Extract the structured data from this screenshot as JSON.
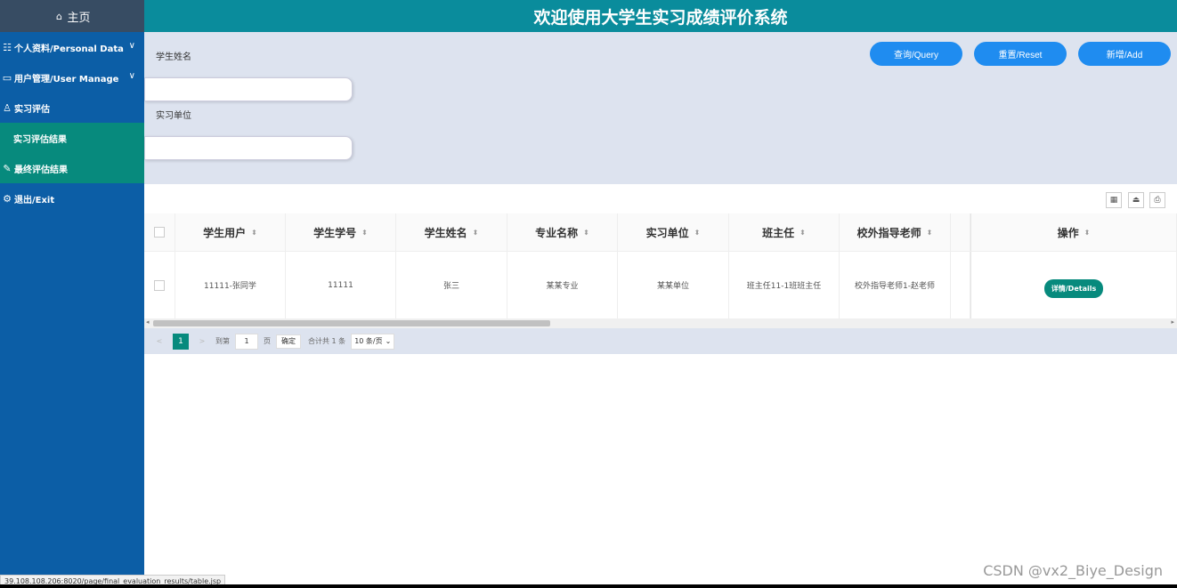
{
  "sidebar": {
    "home_label": "主页",
    "items": [
      {
        "label": "个人资料/Personal Data"
      },
      {
        "label": "用户管理/User Manage"
      },
      {
        "label": "实习评估"
      },
      {
        "label": "实习评估结果"
      },
      {
        "label": "最终评估结果"
      },
      {
        "label": "退出/Exit"
      }
    ]
  },
  "header": {
    "title": "欢迎使用大学生实习成绩评价系统"
  },
  "search": {
    "field1_label": "学生姓名",
    "field1_value": "",
    "field2_label": "实习单位",
    "field2_value": "",
    "query_label": "查询/Query",
    "reset_label": "重置/Reset",
    "add_label": "新增/Add"
  },
  "table": {
    "columns": [
      "学生用户",
      "学生学号",
      "学生姓名",
      "专业名称",
      "实习单位",
      "班主任",
      "校外指导老师",
      "操作"
    ],
    "rows": [
      {
        "user": "11111-张同学",
        "student_no": "11111",
        "name": "张三",
        "major": "某某专业",
        "unit": "某某单位",
        "teacher": "班主任11-1班班主任",
        "mentor": "校外指导老师1-赵老师",
        "action": "详情/Details"
      }
    ]
  },
  "pager": {
    "current_page": "1",
    "goto_label": "到第",
    "goto_value": "1",
    "page_unit": "页",
    "confirm_label": "确定",
    "total_label": "合计共 1 条",
    "page_size": "10 条/页"
  },
  "statusbar": {
    "url": "39.108.108.206:8020/page/final_evaluation_results/table.jsp"
  },
  "watermark": {
    "text": "CSDN @vx2_Biye_Design"
  },
  "colors": {
    "sidebar": "#0c5ea6",
    "header": "#0a8c9c",
    "active": "#078a7d",
    "button": "#1f8cf0"
  }
}
